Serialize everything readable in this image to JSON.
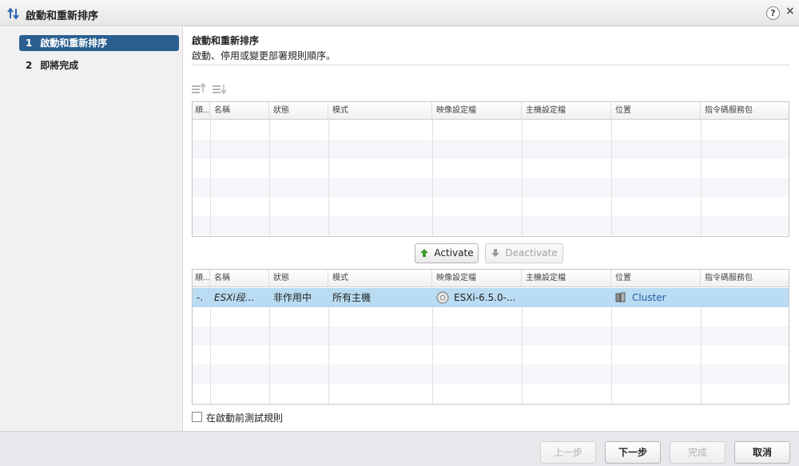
{
  "dialog": {
    "title": "啟動和重新排序",
    "help": "?",
    "close": "×"
  },
  "sidebar": {
    "steps": [
      {
        "num": "1",
        "label": "啟動和重新排序",
        "active": true
      },
      {
        "num": "2",
        "label": "即將完成",
        "active": false
      }
    ]
  },
  "page": {
    "title": "啟動和重新排序",
    "subtitle": "啟動、停用或變更部署規則順序。"
  },
  "toolbar": {
    "icons": [
      "move-up-icon",
      "move-down-icon"
    ]
  },
  "columns": [
    "順...",
    "名稱",
    "狀態",
    "模式",
    "映像設定檔",
    "主機設定檔",
    "位置",
    "指令碼服務包"
  ],
  "active_rules": {
    "rows": []
  },
  "buttons": {
    "activate": "Activate",
    "deactivate": "Deactivate"
  },
  "inactive_rules": {
    "rows": [
      {
        "order": "-.",
        "name": "ESXi段...",
        "status": "非作用中",
        "pattern": "所有主機",
        "image_profile": "ESXi-6.5.0-...",
        "host_profile": "",
        "location": "Cluster",
        "script_bundle": ""
      }
    ]
  },
  "test_rules_checkbox": {
    "label": "在啟動前測試規則",
    "checked": false
  },
  "footer": {
    "back": "上一步",
    "next": "下一步",
    "finish": "完成",
    "cancel": "取消"
  },
  "colors": {
    "selected_step": "#2a5f8f",
    "selected_row": "#b9dcf2",
    "link": "#2b5aa6",
    "activate_icon": "#3c9a2b"
  }
}
